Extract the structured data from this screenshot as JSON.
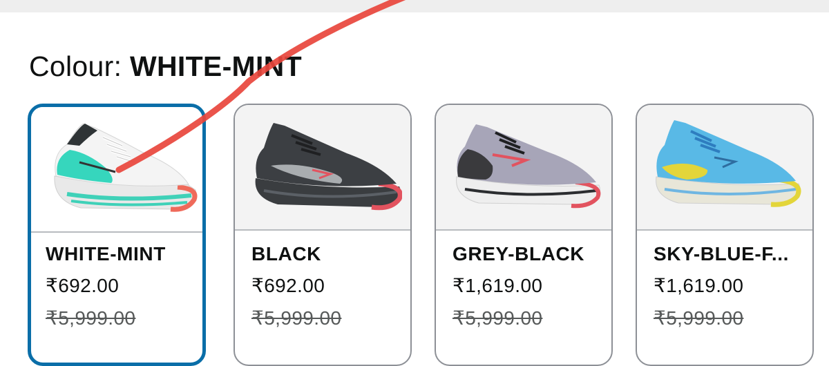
{
  "colour_selector": {
    "label": "Colour:",
    "selected_value": "WHITE-MINT"
  },
  "swatches": [
    {
      "name": "WHITE-MINT",
      "price": "₹692.00",
      "mrp": "₹5,999.00",
      "selected": true,
      "image": "white-mint-shoe"
    },
    {
      "name": "BLACK",
      "price": "₹692.00",
      "mrp": "₹5,999.00",
      "selected": false,
      "image": "black-shoe"
    },
    {
      "name": "GREY-BLACK",
      "price": "₹1,619.00",
      "mrp": "₹5,999.00",
      "selected": false,
      "image": "grey-black-shoe"
    },
    {
      "name": "SKY-BLUE-F...",
      "price": "₹1,619.00",
      "mrp": "₹5,999.00",
      "selected": false,
      "image": "sky-blue-shoe"
    }
  ],
  "colors": {
    "selected_border": "#0a6ea8",
    "annotation_stroke": "#e8453c"
  }
}
